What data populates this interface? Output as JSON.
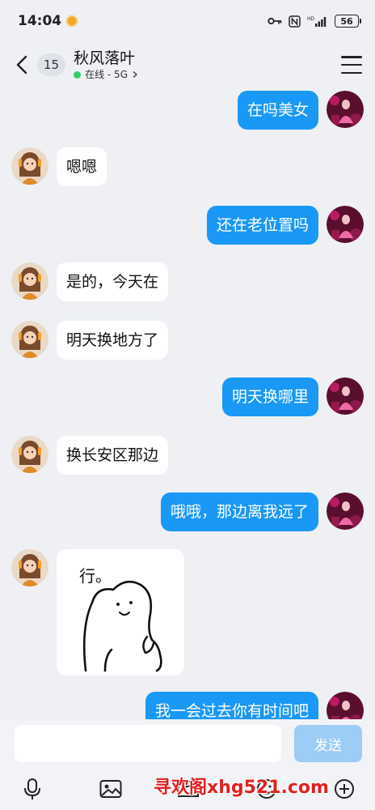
{
  "status_bar": {
    "time": "14:04",
    "battery": "56"
  },
  "header": {
    "unread_count": "15",
    "title": "秋风落叶",
    "presence": "在线 - 5G"
  },
  "messages": [
    {
      "direction": "out",
      "text": "在吗美女"
    },
    {
      "direction": "in",
      "text": "嗯嗯"
    },
    {
      "direction": "out",
      "text": "还在老位置吗"
    },
    {
      "direction": "in",
      "text": "是的，今天在"
    },
    {
      "direction": "in",
      "text": "明天换地方了"
    },
    {
      "direction": "out",
      "text": "明天换哪里"
    },
    {
      "direction": "in",
      "text": "换长安区那边"
    },
    {
      "direction": "out",
      "text": "哦哦，那边离我远了"
    },
    {
      "direction": "in",
      "type": "sticker",
      "sticker_text": "行。"
    },
    {
      "direction": "out",
      "text": "我一会过去你有时间吧"
    }
  ],
  "input": {
    "value": "",
    "send_label": "发送"
  },
  "toolbar": {
    "icons": [
      "microphone-icon",
      "image-icon",
      "camera-icon",
      "emoji-icon",
      "plus-icon"
    ]
  },
  "watermark": "寻欢阁xhg521.com",
  "colors": {
    "outgoing_bubble": "#1a98f5",
    "incoming_bubble": "#ffffff",
    "background": "#eef0f4",
    "send_button": "#9dccf5",
    "online": "#2fd06a"
  }
}
